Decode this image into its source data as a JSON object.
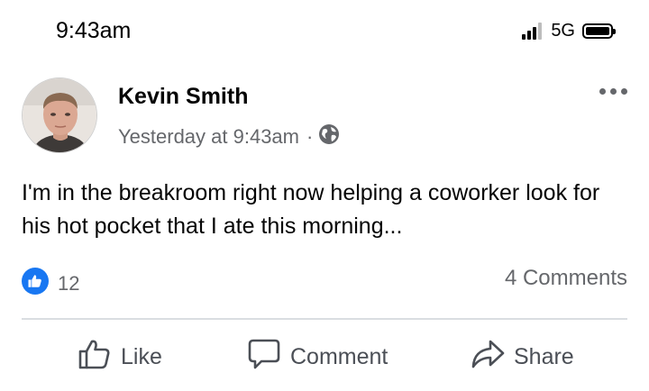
{
  "status_bar": {
    "time": "9:43am",
    "network": "5G",
    "icons": [
      "signal-icon",
      "battery-icon"
    ]
  },
  "post": {
    "author": "Kevin Smith",
    "timestamp": "Yesterday at 9:43am",
    "separator": "·",
    "audience_icon": "globe-icon",
    "text": "I'm in the breakroom right now helping a coworker look for his hot pocket that I ate this morning...",
    "reactions": {
      "icon": "like-reaction-icon",
      "count": "12"
    },
    "comments_label": "4 Comments"
  },
  "actions": {
    "like": "Like",
    "comment": "Comment",
    "share": "Share"
  },
  "colors": {
    "like_blue": "#1877f2",
    "secondary_text": "#65676b",
    "primary_text": "#050505",
    "divider": "#dadde1"
  }
}
